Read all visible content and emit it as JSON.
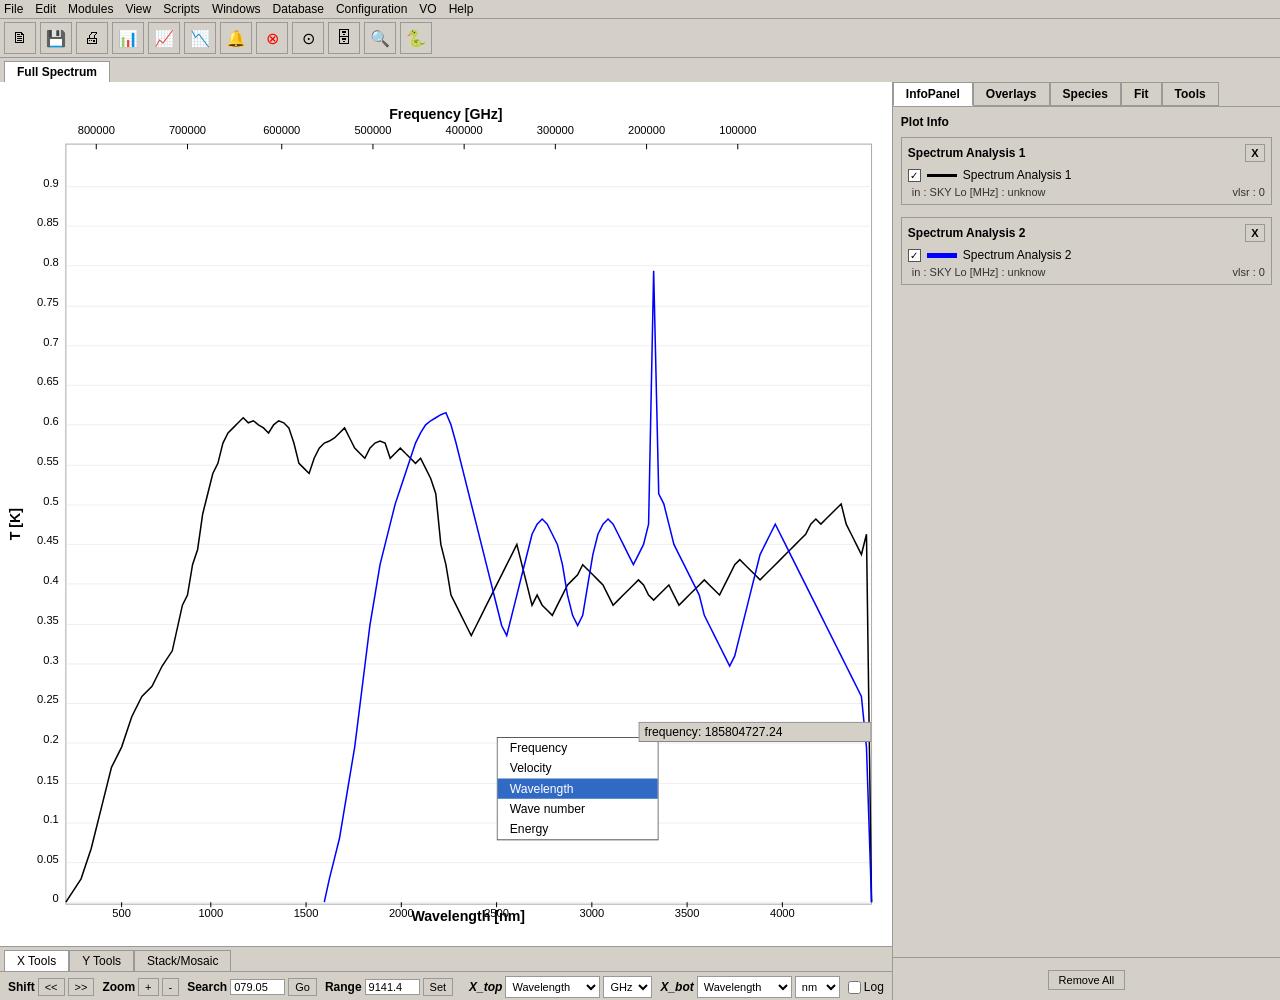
{
  "menubar": {
    "items": [
      "File",
      "Edit",
      "Modules",
      "View",
      "Scripts",
      "Windows",
      "Database",
      "Configuration",
      "VO",
      "Help"
    ]
  },
  "toolbar": {
    "buttons": [
      "📄",
      "💾",
      "🖨",
      "📊",
      "📈",
      "📉",
      "🔔",
      "🔴",
      "⭕",
      "🗄",
      "🔍",
      "🐍"
    ]
  },
  "tabs": {
    "active": "Full Spectrum",
    "items": [
      "Full Spectrum"
    ]
  },
  "plot": {
    "title_top": "Frequency [GHz]",
    "title_bottom": "Wavelength [nm]",
    "title_left": "T [K]",
    "x_top_labels": [
      "800000",
      "700000",
      "600000",
      "500000",
      "400000",
      "300000",
      "200000",
      "100000"
    ],
    "x_bottom_labels": [
      "500",
      "1000",
      "1500",
      "2000",
      "2500",
      "3000",
      "3500",
      "4000"
    ],
    "y_labels": [
      "0",
      "0.05",
      "0.1",
      "0.15",
      "0.2",
      "0.25",
      "0.3",
      "0.35",
      "0.4",
      "0.45",
      "0.5",
      "0.55",
      "0.6",
      "0.65",
      "0.7",
      "0.75",
      "0.8",
      "0.85",
      "0.9"
    ]
  },
  "right_panel": {
    "tabs": [
      "InfoPanel",
      "Overlays",
      "Species",
      "Fit",
      "Tools"
    ],
    "active_tab": "InfoPanel",
    "plot_info_label": "Plot Info",
    "spectra": [
      {
        "id": 1,
        "title": "Spectrum Analysis 1",
        "color": "black",
        "label": "Spectrum Analysis 1",
        "info": "in : SKY Lo [MHz] : unknow",
        "vlsr": "vlsr : 0"
      },
      {
        "id": 2,
        "title": "Spectrum Analysis 2",
        "color": "blue",
        "label": "Spectrum Analysis 2",
        "info": "in : SKY Lo [MHz] : unknow",
        "vlsr": "vlsr : 0"
      }
    ],
    "remove_all_label": "Remove All"
  },
  "bottom_tools": {
    "tabs": [
      "X Tools",
      "Y Tools",
      "Stack/Mosaic"
    ],
    "active_tab": "X Tools",
    "shift_label": "Shift",
    "zoom_label": "Zoom",
    "search_label": "Search",
    "range_label": "Range",
    "nav_prev": "<<",
    "nav_next": ">>",
    "zoom_in": "+",
    "zoom_out": "-",
    "search_value": "079.05",
    "go_label": "Go",
    "range_value": "9141.4",
    "set_label": "Set"
  },
  "axis_controls": {
    "xtop_label": "X_top",
    "xbot_label": "X_bot",
    "xtop_selected": "Wavelength",
    "xbot_selected": "Wavelength",
    "xtop_unit": "GHz",
    "xbot_unit": "nm",
    "log_label": "Log"
  },
  "dropdown": {
    "items": [
      "Frequency",
      "Velocity",
      "Wavelength",
      "Wave number",
      "Energy"
    ],
    "selected": "Wavelength",
    "position": "xtop"
  },
  "frequency_display": {
    "label": "frequency: 185804727.24"
  }
}
